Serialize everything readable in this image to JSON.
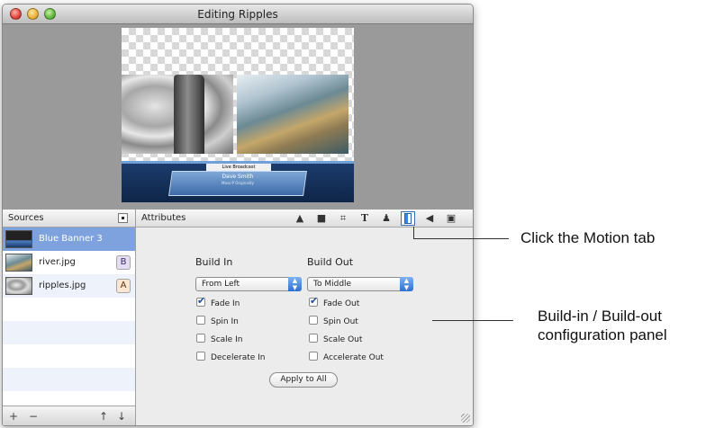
{
  "window": {
    "title": "Editing Ripples"
  },
  "preview": {
    "lower_third_tab": "Live Broadcast",
    "lower_third_name": "Dave Smith",
    "lower_third_subtitle": "Mass-P Originality"
  },
  "sources": {
    "header": "Sources",
    "items": [
      {
        "label": "Blue Banner 3",
        "tag": "",
        "selected": true
      },
      {
        "label": "river.jpg",
        "tag": "B"
      },
      {
        "label": "ripples.jpg",
        "tag": "A"
      }
    ],
    "footer": {
      "add": "+",
      "remove": "−",
      "up": "↑",
      "down": "↓"
    }
  },
  "attributes": {
    "header": "Attributes",
    "tabs": [
      {
        "name": "shapes-icon",
        "glyph": "▲"
      },
      {
        "name": "flag-icon",
        "glyph": "■"
      },
      {
        "name": "crop-icon",
        "glyph": "⌗"
      },
      {
        "name": "text-icon",
        "glyph": "T"
      },
      {
        "name": "person-icon",
        "glyph": "♟"
      },
      {
        "name": "motion-icon",
        "glyph": "",
        "active": true
      },
      {
        "name": "audio-icon",
        "glyph": "◀"
      },
      {
        "name": "layout-icon",
        "glyph": "▣"
      }
    ],
    "build_in": {
      "title": "Build In",
      "selected": "From Left",
      "options": [
        "Fade In",
        "Spin In",
        "Scale In",
        "Decelerate In"
      ],
      "checked": [
        true,
        false,
        false,
        false
      ]
    },
    "build_out": {
      "title": "Build Out",
      "selected": "To Middle",
      "options": [
        "Fade Out",
        "Spin Out",
        "Scale Out",
        "Accelerate Out"
      ],
      "checked": [
        true,
        false,
        false,
        false
      ]
    },
    "apply_label": "Apply to All"
  },
  "callouts": {
    "motion": "Click the Motion tab",
    "panel_line1": "Build-in / Build-out",
    "panel_line2": "configuration panel"
  },
  "colors": {
    "selection": "#7ea2dd",
    "accent": "#2f6fd0"
  }
}
